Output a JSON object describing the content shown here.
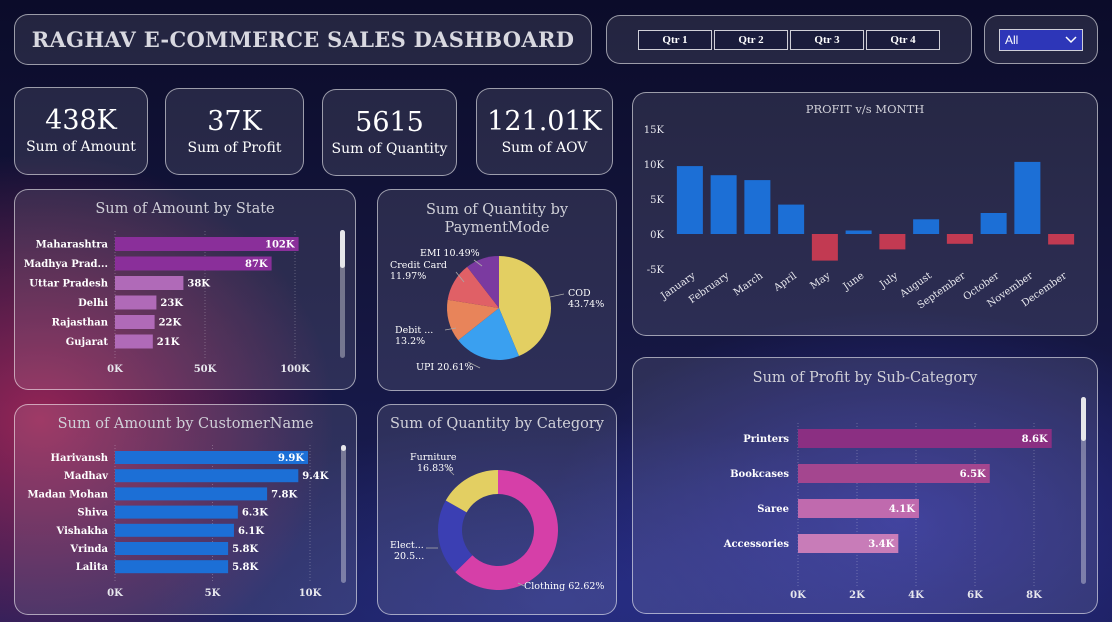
{
  "header": {
    "title": "RAGHAV E-COMMERCE SALES DASHBOARD"
  },
  "filters": {
    "quarters": [
      "Qtr 1",
      "Qtr 2",
      "Qtr 3",
      "Qtr 4"
    ],
    "dropdown_value": "All"
  },
  "kpis": [
    {
      "value": "438K",
      "label": "Sum of Amount"
    },
    {
      "value": "37K",
      "label": "Sum of Profit"
    },
    {
      "value": "5615",
      "label": "Sum of Quantity"
    },
    {
      "value": "121.01K",
      "label": "Sum of AOV"
    }
  ],
  "colors": {
    "purple_dark": "#8a2f9a",
    "purple_light": "#b06ab8",
    "blue_bar": "#1c6fd6",
    "red_bar": "#c23a52",
    "pink": "#d63fa8",
    "yellow": "#e3cf62",
    "orange": "#e8845a",
    "salmon": "#e06066",
    "sky": "#3aa0f0",
    "indigo": "#3b3fb3"
  },
  "chart_data": [
    {
      "id": "amount_by_state",
      "type": "bar",
      "orientation": "horizontal",
      "title": "Sum of Amount by State",
      "categories": [
        "Maharashtra",
        "Madhya Prad...",
        "Uttar Pradesh",
        "Delhi",
        "Rajasthan",
        "Gujarat"
      ],
      "values": [
        102,
        87,
        38,
        23,
        22,
        21
      ],
      "data_labels": [
        "102K",
        "87K",
        "38K",
        "23K",
        "22K",
        "21K"
      ],
      "xticks": [
        "0K",
        "50K",
        "100K"
      ],
      "xlim": [
        0,
        100
      ]
    },
    {
      "id": "quantity_by_paymentmode",
      "type": "pie",
      "title": "Sum of Quantity by PaymentMode",
      "labels": [
        "COD",
        "UPI",
        "Debit ...",
        "Credit Card",
        "EMI"
      ],
      "values": [
        43.74,
        20.61,
        13.2,
        11.97,
        10.49
      ],
      "data_labels": [
        "COD 43.74%",
        "UPI 20.61%",
        "Debit ... 13.2%",
        "Credit Card 11.97%",
        "EMI 10.49%"
      ]
    },
    {
      "id": "profit_vs_month",
      "type": "bar",
      "title": "PROFIT v/s MONTH",
      "categories": [
        "January",
        "February",
        "March",
        "April",
        "May",
        "June",
        "July",
        "August",
        "September",
        "October",
        "November",
        "December"
      ],
      "values": [
        9.7,
        8.4,
        7.7,
        4.2,
        -3.8,
        0.5,
        -2.2,
        2.1,
        -1.4,
        3.0,
        10.3,
        -1.5
      ],
      "yticks": [
        "15K",
        "10K",
        "5K",
        "0K",
        "-5K"
      ],
      "ylim": [
        -5,
        15
      ]
    },
    {
      "id": "amount_by_customer",
      "type": "bar",
      "orientation": "horizontal",
      "title": "Sum of Amount by CustomerName",
      "categories": [
        "Harivansh",
        "Madhav",
        "Madan Mohan",
        "Shiva",
        "Vishakha",
        "Vrinda",
        "Lalita"
      ],
      "values": [
        9.9,
        9.4,
        7.8,
        6.3,
        6.1,
        5.8,
        5.8
      ],
      "data_labels": [
        "9.9K",
        "9.4K",
        "7.8K",
        "6.3K",
        "6.1K",
        "5.8K",
        "5.8K"
      ],
      "xticks": [
        "0K",
        "5K",
        "10K"
      ],
      "xlim": [
        0,
        10
      ]
    },
    {
      "id": "quantity_by_category",
      "type": "pie",
      "subtype": "donut",
      "title": "Sum of Quantity by Category",
      "labels": [
        "Clothing",
        "Electronics",
        "Furniture"
      ],
      "values": [
        62.62,
        20.55,
        16.83
      ],
      "data_labels": [
        "Clothing 62.62%",
        "Elect... 20.5...",
        "Furniture 16.83%"
      ]
    },
    {
      "id": "profit_by_subcategory",
      "type": "bar",
      "orientation": "horizontal",
      "title": "Sum of Profit by Sub-Category",
      "categories": [
        "Printers",
        "Bookcases",
        "Saree",
        "Accessories"
      ],
      "values": [
        8.6,
        6.5,
        4.1,
        3.4
      ],
      "data_labels": [
        "8.6K",
        "6.5K",
        "4.1K",
        "3.4K"
      ],
      "xticks": [
        "0K",
        "2K",
        "4K",
        "6K",
        "8K"
      ],
      "xlim": [
        0,
        8
      ]
    }
  ]
}
